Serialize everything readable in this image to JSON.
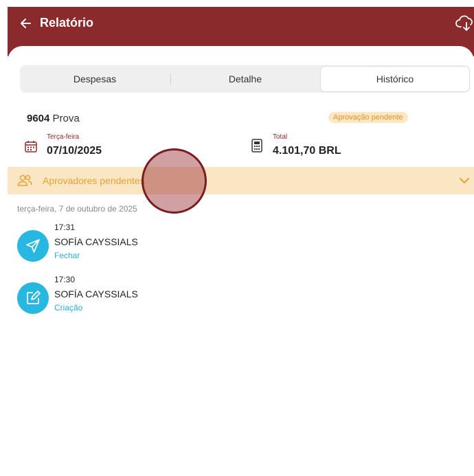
{
  "header": {
    "title": "Relatório",
    "back_icon": "arrow-left-icon",
    "download_icon": "cloud-download-icon",
    "background_color": "#8a2a2c"
  },
  "tabs": [
    {
      "label": "Despesas",
      "selected": false
    },
    {
      "label": "Detalhe",
      "selected": false
    },
    {
      "label": "Histórico",
      "selected": true
    }
  ],
  "report": {
    "number": "9604",
    "name": "Prova",
    "status_badge": "Aprovação pendente",
    "date_label": "Terça-feira",
    "date_value": "07/10/2025",
    "total_label": "Total",
    "total_value": "4.101,70 BRL"
  },
  "approvers": {
    "label": "Aprovadores pendentes",
    "icon": "people-icon",
    "expand_icon": "chevron-down-icon"
  },
  "history": {
    "date_heading": "terça-feira, 7 de outubro de 2025",
    "items": [
      {
        "time": "17:31",
        "name": "SOFÍA CAYSSIALS",
        "action": "Fechar",
        "icon": "send-icon"
      },
      {
        "time": "17:30",
        "name": "SOFÍA CAYSSIALS",
        "action": "Criação",
        "icon": "edit-icon"
      }
    ]
  },
  "colors": {
    "accent": "#8a2a2c",
    "badge_bg": "#fde7c2",
    "badge_text": "#e2932a",
    "history_icon": "#27b7e0"
  }
}
